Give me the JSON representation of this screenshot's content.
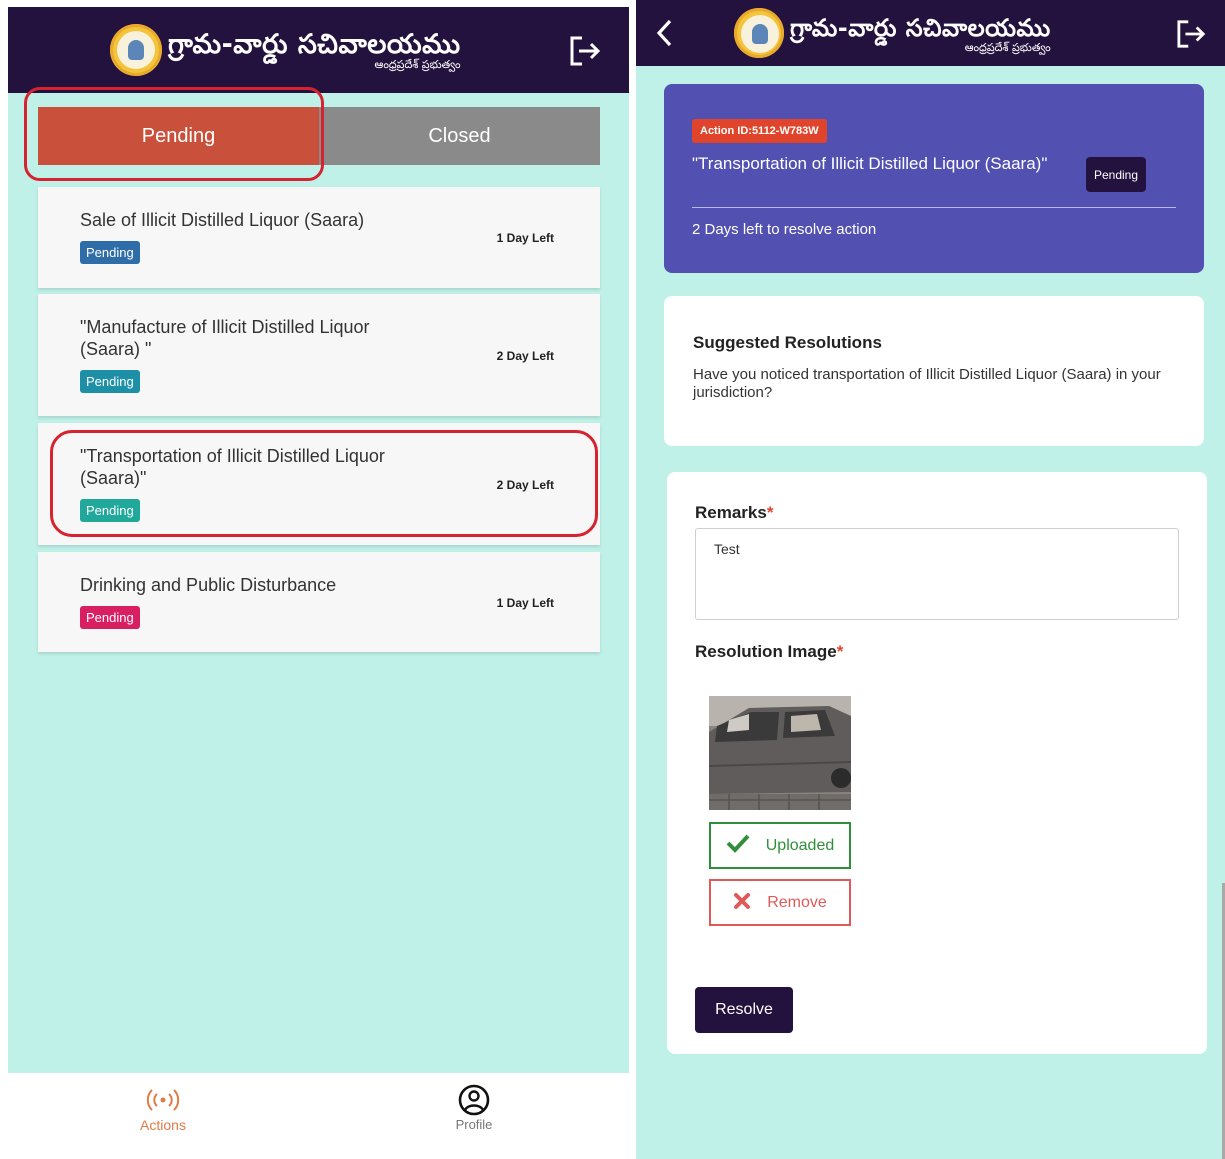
{
  "brand": {
    "title": "గ్రామ-వార్డు సచివాలయము",
    "subtitle": "ఆంధ్రప్రదేశ్ ప్రభుత్వం"
  },
  "left": {
    "tabs": [
      {
        "label": "Pending",
        "color": "#c9503a",
        "selected": true
      },
      {
        "label": "Closed",
        "color": "#8a8a8a",
        "selected": false
      }
    ],
    "items": [
      {
        "title": "Sale of Illicit Distilled Liquor (Saara)",
        "badge": "Pending",
        "badge_color": "#2f6da8",
        "days": "1 Day Left"
      },
      {
        "title": "\"Manufacture of Illicit Distilled Liquor (Saara) \"",
        "badge": "Pending",
        "badge_color": "#1d8fa7",
        "days": "2 Day Left"
      },
      {
        "title": "\"Transportation of Illicit Distilled Liquor (Saara)\"",
        "badge": "Pending",
        "badge_color": "#20a99a",
        "days": "2 Day Left",
        "highlighted": true
      },
      {
        "title": "Drinking and Public Disturbance",
        "badge": "Pending",
        "badge_color": "#d81f62",
        "days": "1 Day Left"
      }
    ],
    "bottom_nav": [
      {
        "label": "Actions",
        "icon": "broadcast-icon",
        "active": true,
        "color": "#e07b45"
      },
      {
        "label": "Profile",
        "icon": "user-circle-icon",
        "active": false,
        "color": "#777777"
      }
    ]
  },
  "right": {
    "action": {
      "id": "Action ID:5112-W783W",
      "title": "\"Transportation of Illicit Distilled Liquor (Saara)\"",
      "status": "Pending",
      "days_left": "2 Days left to resolve action",
      "bg_color": "#5250b1"
    },
    "suggested": {
      "heading": "Suggested Resolutions",
      "text": "Have you noticed transportation of Illicit Distilled Liquor (Saara) in your jurisdiction?"
    },
    "form": {
      "remarks_label": "Remarks",
      "remarks_value": "Test",
      "image_label": "Resolution Image",
      "required_mark": "*",
      "uploaded_label": "Uploaded",
      "remove_label": "Remove",
      "resolve_label": "Resolve"
    }
  },
  "colors": {
    "appbar": "#24123e",
    "background": "#bff1e9",
    "accent_red": "#e0452b"
  }
}
